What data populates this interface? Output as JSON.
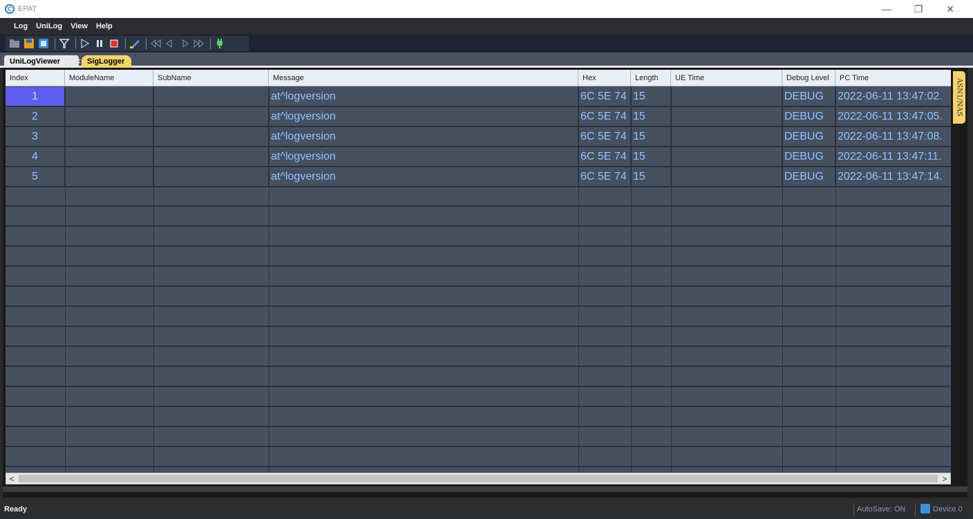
{
  "window": {
    "title": "EPAT",
    "minimize_glyph": "—",
    "restore_glyph": "❐",
    "close_glyph": "✕"
  },
  "menu": [
    "Log",
    "UniLog",
    "View",
    "Help"
  ],
  "toolbar": {
    "icons": [
      "open-icon",
      "save-icon",
      "database-icon",
      "filter-icon",
      "play-icon",
      "pause-icon",
      "stop-icon",
      "clear-icon",
      "first-icon",
      "prev-icon",
      "next-icon",
      "last-icon",
      "plug-icon"
    ]
  },
  "tabs": {
    "active": "UniLogViewer",
    "close": "✕",
    "second": "SigLogger"
  },
  "side_tab": "ASN1/NAS",
  "table": {
    "columns": [
      "Index",
      "ModuleName",
      "SubName",
      "Message",
      "Hex",
      "Length",
      "UE Time",
      "Debug Level",
      "PC Time"
    ],
    "rows": [
      {
        "index": "1",
        "module": "",
        "sub": "",
        "message": "at^logversion",
        "hex": "6C 5E 74",
        "length": "15",
        "ue_time": "",
        "level": "DEBUG",
        "pc_time": "2022-06-11 13:47:02."
      },
      {
        "index": "2",
        "module": "",
        "sub": "",
        "message": "at^logversion",
        "hex": "6C 5E 74",
        "length": "15",
        "ue_time": "",
        "level": "DEBUG",
        "pc_time": "2022-06-11 13:47:05."
      },
      {
        "index": "3",
        "module": "",
        "sub": "",
        "message": "at^logversion",
        "hex": "6C 5E 74",
        "length": "15",
        "ue_time": "",
        "level": "DEBUG",
        "pc_time": "2022-06-11 13:47:08."
      },
      {
        "index": "4",
        "module": "",
        "sub": "",
        "message": "at^logversion",
        "hex": "6C 5E 74",
        "length": "15",
        "ue_time": "",
        "level": "DEBUG",
        "pc_time": "2022-06-11 13:47:11."
      },
      {
        "index": "5",
        "module": "",
        "sub": "",
        "message": "at^logversion",
        "hex": "6C 5E 74",
        "length": "15",
        "ue_time": "",
        "level": "DEBUG",
        "pc_time": "2022-06-11 13:47:14."
      }
    ],
    "selected_row": 0
  },
  "scrollbar": {
    "left": "<",
    "right": ">"
  },
  "status": {
    "left": "Ready",
    "autosave": "AutoSave: ON",
    "device": "Device 0"
  },
  "colors": {
    "grid_bg": "#465061",
    "cell_text": "#8fc2ff",
    "selection": "#5d5df0",
    "tab_highlight": "#f3d36b"
  }
}
